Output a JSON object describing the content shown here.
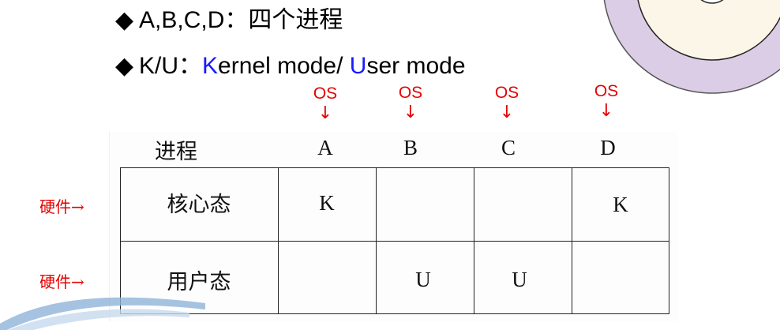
{
  "bullets": {
    "marker": "◆",
    "line1": "A,B,C,D：四个进程",
    "line2_prefix": "K/U：",
    "line2_k": "K",
    "line2_mid": "ernel mode/ ",
    "line2_u": "U",
    "line2_end": "ser mode"
  },
  "os_markers": {
    "label": "OS",
    "arrow": "↓"
  },
  "table": {
    "header_label": "进程",
    "processes": [
      "A",
      "B",
      "C",
      "D"
    ],
    "rows": [
      {
        "label": "核心态",
        "cells": [
          "K",
          "",
          "",
          "K"
        ]
      },
      {
        "label": "用户态",
        "cells": [
          "",
          "U",
          "U",
          ""
        ]
      }
    ]
  },
  "hardware_label": "硬件→",
  "colors": {
    "accent_red": "#e60000",
    "accent_blue": "#1a1aff",
    "disc": "#d9c9e3"
  }
}
